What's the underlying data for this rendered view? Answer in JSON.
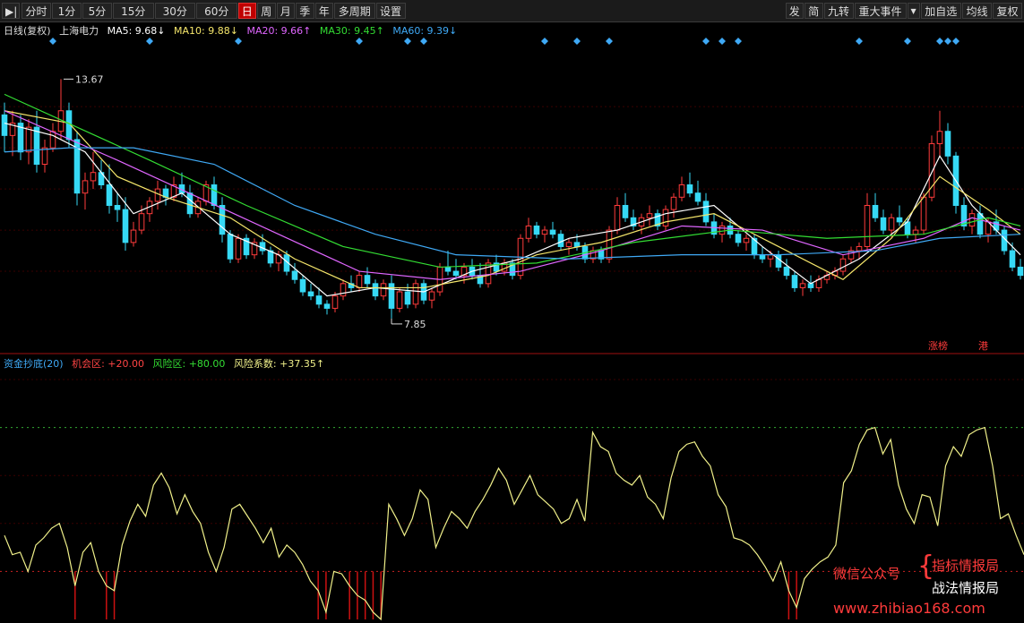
{
  "toolbar": {
    "left": [
      {
        "label": "分时"
      },
      {
        "label": "1分"
      },
      {
        "label": "5分"
      },
      {
        "label": "15分"
      },
      {
        "label": "30分"
      },
      {
        "label": "60分"
      },
      {
        "label": "日",
        "active": true
      },
      {
        "label": "周"
      },
      {
        "label": "月"
      },
      {
        "label": "季"
      },
      {
        "label": "年"
      },
      {
        "label": "多周期"
      },
      {
        "label": "设置"
      }
    ],
    "right": [
      {
        "label": "发"
      },
      {
        "label": "简"
      },
      {
        "label": "九转"
      },
      {
        "label": "重大事件"
      },
      {
        "label": "加自选"
      },
      {
        "label": "均线"
      },
      {
        "label": "复权"
      }
    ]
  },
  "legend": {
    "period": "日线(复权)",
    "stock": "上海电力",
    "ma5": "MA5: 9.68↓",
    "ma10": "MA10: 9.88↓",
    "ma20": "MA20: 9.66↑",
    "ma30": "MA30: 9.45↑",
    "ma60": "MA60: 9.39↓"
  },
  "colors": {
    "up": "#ff3b3b",
    "down": "#36d9f5",
    "ma5": "#ffffff",
    "ma10": "#f5e66b",
    "ma20": "#e066ff",
    "ma30": "#33dd33",
    "ma60": "#3fa9f5",
    "indicator": "#f0f08a"
  },
  "annotations": {
    "high_label": "13.67",
    "low_label": "7.85",
    "tag_zhangbang": "涨榜",
    "tag_gang": "港"
  },
  "indicator_legend": {
    "name": "资金抄底(20)",
    "chance": "机会区: +20.00",
    "risk": "风险区: +80.00",
    "coef": "风险系数: +37.35↑"
  },
  "watermark": {
    "wechat": "微信公众号",
    "line1": "指标情报局",
    "line2": "战法情报局",
    "url": "www.zhibiao168.com"
  },
  "chart_data": {
    "type": "candlestick",
    "title": "",
    "y_price_range": [
      7.5,
      14.2
    ],
    "high": 13.67,
    "low": 7.85,
    "candles": [
      [
        12.8,
        13.1,
        11.9,
        12.3
      ],
      [
        12.3,
        12.9,
        11.8,
        12.6
      ],
      [
        12.6,
        12.8,
        11.7,
        11.9
      ],
      [
        11.9,
        12.7,
        11.6,
        12.5
      ],
      [
        12.5,
        12.9,
        11.4,
        11.6
      ],
      [
        11.6,
        12.2,
        11.4,
        12.0
      ],
      [
        12.0,
        12.6,
        11.9,
        12.4
      ],
      [
        12.4,
        13.67,
        12.2,
        12.9
      ],
      [
        12.9,
        13.1,
        12.0,
        12.2
      ],
      [
        12.2,
        12.4,
        10.6,
        10.9
      ],
      [
        10.9,
        11.4,
        10.5,
        11.2
      ],
      [
        11.2,
        11.9,
        11.0,
        11.4
      ],
      [
        11.4,
        11.7,
        11.0,
        11.1
      ],
      [
        11.1,
        11.6,
        10.4,
        10.6
      ],
      [
        10.6,
        10.9,
        10.2,
        10.5
      ],
      [
        10.5,
        10.8,
        9.5,
        9.7
      ],
      [
        9.7,
        10.2,
        9.6,
        10.0
      ],
      [
        10.0,
        10.6,
        9.9,
        10.4
      ],
      [
        10.4,
        10.8,
        10.2,
        10.7
      ],
      [
        10.7,
        11.2,
        10.5,
        11.0
      ],
      [
        11.0,
        11.1,
        10.6,
        10.8
      ],
      [
        10.8,
        11.3,
        10.7,
        11.1
      ],
      [
        11.1,
        11.4,
        10.8,
        10.9
      ],
      [
        10.9,
        11.1,
        10.3,
        10.4
      ],
      [
        10.4,
        10.8,
        10.3,
        10.7
      ],
      [
        10.7,
        11.2,
        10.6,
        11.1
      ],
      [
        11.1,
        11.3,
        10.5,
        10.6
      ],
      [
        10.6,
        10.8,
        9.7,
        9.9
      ],
      [
        9.9,
        10.0,
        9.2,
        9.3
      ],
      [
        9.3,
        9.9,
        9.2,
        9.8
      ],
      [
        9.8,
        9.9,
        9.3,
        9.4
      ],
      [
        9.4,
        9.8,
        9.3,
        9.7
      ],
      [
        9.7,
        9.9,
        9.4,
        9.5
      ],
      [
        9.5,
        9.6,
        9.1,
        9.2
      ],
      [
        9.2,
        9.5,
        9.0,
        9.4
      ],
      [
        9.4,
        9.5,
        8.9,
        9.0
      ],
      [
        9.0,
        9.2,
        8.7,
        8.8
      ],
      [
        8.8,
        8.9,
        8.4,
        8.5
      ],
      [
        8.5,
        8.7,
        8.3,
        8.4
      ],
      [
        8.4,
        8.6,
        8.1,
        8.2
      ],
      [
        8.2,
        8.3,
        7.95,
        8.1
      ],
      [
        8.1,
        8.5,
        8.0,
        8.4
      ],
      [
        8.4,
        8.8,
        8.3,
        8.7
      ],
      [
        8.7,
        8.9,
        8.5,
        8.6
      ],
      [
        8.6,
        9.0,
        8.5,
        8.9
      ],
      [
        8.9,
        9.1,
        8.6,
        8.7
      ],
      [
        8.7,
        8.8,
        8.3,
        8.4
      ],
      [
        8.4,
        8.8,
        8.3,
        8.7
      ],
      [
        8.7,
        8.9,
        7.85,
        8.1
      ],
      [
        8.1,
        8.6,
        8.0,
        8.5
      ],
      [
        8.5,
        8.7,
        8.1,
        8.2
      ],
      [
        8.2,
        8.8,
        8.1,
        8.7
      ],
      [
        8.7,
        8.8,
        8.2,
        8.3
      ],
      [
        8.3,
        8.6,
        8.1,
        8.5
      ],
      [
        8.5,
        9.2,
        8.4,
        9.1
      ],
      [
        9.1,
        9.5,
        8.9,
        9.0
      ],
      [
        9.0,
        9.3,
        8.8,
        8.9
      ],
      [
        8.9,
        9.2,
        8.7,
        9.1
      ],
      [
        9.1,
        9.3,
        8.8,
        8.9
      ],
      [
        8.9,
        9.2,
        8.6,
        8.7
      ],
      [
        8.7,
        9.3,
        8.6,
        9.2
      ],
      [
        9.2,
        9.4,
        8.9,
        9.0
      ],
      [
        9.0,
        9.3,
        8.9,
        9.2
      ],
      [
        9.2,
        9.3,
        8.8,
        8.9
      ],
      [
        8.9,
        9.9,
        8.8,
        9.8
      ],
      [
        9.8,
        10.3,
        9.7,
        10.1
      ],
      [
        10.1,
        10.2,
        9.8,
        9.9
      ],
      [
        9.9,
        10.1,
        9.7,
        10.0
      ],
      [
        10.0,
        10.2,
        9.8,
        9.9
      ],
      [
        9.9,
        10.0,
        9.5,
        9.6
      ],
      [
        9.6,
        9.8,
        9.4,
        9.7
      ],
      [
        9.7,
        9.9,
        9.5,
        9.6
      ],
      [
        9.6,
        9.7,
        9.2,
        9.3
      ],
      [
        9.3,
        9.6,
        9.2,
        9.5
      ],
      [
        9.5,
        9.6,
        9.2,
        9.3
      ],
      [
        9.3,
        10.1,
        9.2,
        10.0
      ],
      [
        10.0,
        10.8,
        9.9,
        10.6
      ],
      [
        10.6,
        10.9,
        10.2,
        10.3
      ],
      [
        10.3,
        10.5,
        10.0,
        10.1
      ],
      [
        10.1,
        10.4,
        9.9,
        10.3
      ],
      [
        10.3,
        10.6,
        10.1,
        10.4
      ],
      [
        10.4,
        10.5,
        10.0,
        10.1
      ],
      [
        10.1,
        10.6,
        10.0,
        10.5
      ],
      [
        10.5,
        10.9,
        10.3,
        10.8
      ],
      [
        10.8,
        11.3,
        10.7,
        11.1
      ],
      [
        11.1,
        11.4,
        10.8,
        10.9
      ],
      [
        10.9,
        11.2,
        10.6,
        10.7
      ],
      [
        10.7,
        10.9,
        10.1,
        10.2
      ],
      [
        10.2,
        10.4,
        9.8,
        9.9
      ],
      [
        9.9,
        10.2,
        9.7,
        10.1
      ],
      [
        10.1,
        10.3,
        9.8,
        9.9
      ],
      [
        9.9,
        10.0,
        9.6,
        9.7
      ],
      [
        9.7,
        9.9,
        9.5,
        9.8
      ],
      [
        9.8,
        9.9,
        9.3,
        9.4
      ],
      [
        9.4,
        9.6,
        9.2,
        9.3
      ],
      [
        9.3,
        9.5,
        9.1,
        9.4
      ],
      [
        9.4,
        9.5,
        9.0,
        9.1
      ],
      [
        9.1,
        9.3,
        8.8,
        8.9
      ],
      [
        8.9,
        9.0,
        8.5,
        8.6
      ],
      [
        8.6,
        8.8,
        8.4,
        8.7
      ],
      [
        8.7,
        8.9,
        8.5,
        8.6
      ],
      [
        8.6,
        8.9,
        8.5,
        8.8
      ],
      [
        8.8,
        9.0,
        8.7,
        8.9
      ],
      [
        8.9,
        9.1,
        8.8,
        9.0
      ],
      [
        9.0,
        9.4,
        8.9,
        9.3
      ],
      [
        9.3,
        9.6,
        9.2,
        9.5
      ],
      [
        9.5,
        9.7,
        9.3,
        9.6
      ],
      [
        9.6,
        10.9,
        9.5,
        10.6
      ],
      [
        10.6,
        10.9,
        10.2,
        10.3
      ],
      [
        10.3,
        10.5,
        9.9,
        10.0
      ],
      [
        10.0,
        10.4,
        9.8,
        10.3
      ],
      [
        10.3,
        10.6,
        10.1,
        10.2
      ],
      [
        10.2,
        10.3,
        9.8,
        9.9
      ],
      [
        9.9,
        10.1,
        9.7,
        10.0
      ],
      [
        10.0,
        10.9,
        9.9,
        10.8
      ],
      [
        10.8,
        12.3,
        10.7,
        12.1
      ],
      [
        12.1,
        12.9,
        11.8,
        12.4
      ],
      [
        12.4,
        12.6,
        11.6,
        11.8
      ],
      [
        11.8,
        11.9,
        10.4,
        10.6
      ],
      [
        10.6,
        10.8,
        10.0,
        10.1
      ],
      [
        10.1,
        10.5,
        9.9,
        10.4
      ],
      [
        10.4,
        10.6,
        9.8,
        9.9
      ],
      [
        9.9,
        10.3,
        9.7,
        10.2
      ],
      [
        10.2,
        10.5,
        9.9,
        10.0
      ],
      [
        10.0,
        10.1,
        9.4,
        9.5
      ],
      [
        9.5,
        9.7,
        9.0,
        9.1
      ],
      [
        9.1,
        9.3,
        8.8,
        8.9
      ]
    ],
    "ma_lines": [
      {
        "key": "ma5",
        "points": [
          [
            0,
            12.6
          ],
          [
            6,
            12.3
          ],
          [
            10,
            11.9
          ],
          [
            16,
            10.4
          ],
          [
            22,
            10.9
          ],
          [
            28,
            9.9
          ],
          [
            34,
            9.4
          ],
          [
            40,
            8.4
          ],
          [
            46,
            8.6
          ],
          [
            52,
            8.5
          ],
          [
            58,
            9.0
          ],
          [
            64,
            9.3
          ],
          [
            70,
            9.8
          ],
          [
            76,
            10.0
          ],
          [
            82,
            10.4
          ],
          [
            88,
            10.6
          ],
          [
            94,
            9.6
          ],
          [
            100,
            8.7
          ],
          [
            106,
            9.3
          ],
          [
            112,
            10.2
          ],
          [
            116,
            11.8
          ],
          [
            120,
            10.6
          ],
          [
            126,
            9.4
          ]
        ]
      },
      {
        "key": "ma10",
        "points": [
          [
            0,
            12.9
          ],
          [
            8,
            12.6
          ],
          [
            14,
            11.3
          ],
          [
            20,
            10.8
          ],
          [
            28,
            10.3
          ],
          [
            36,
            9.3
          ],
          [
            44,
            8.6
          ],
          [
            52,
            8.6
          ],
          [
            60,
            8.9
          ],
          [
            66,
            9.4
          ],
          [
            74,
            9.7
          ],
          [
            82,
            10.2
          ],
          [
            88,
            10.4
          ],
          [
            96,
            9.6
          ],
          [
            104,
            8.8
          ],
          [
            110,
            9.8
          ],
          [
            116,
            11.3
          ],
          [
            122,
            10.5
          ],
          [
            126,
            9.9
          ]
        ]
      },
      {
        "key": "ma20",
        "points": [
          [
            0,
            12.9
          ],
          [
            14,
            11.7
          ],
          [
            24,
            10.8
          ],
          [
            34,
            9.9
          ],
          [
            44,
            9.0
          ],
          [
            54,
            8.8
          ],
          [
            64,
            9.0
          ],
          [
            74,
            9.5
          ],
          [
            84,
            10.1
          ],
          [
            94,
            10.0
          ],
          [
            104,
            9.4
          ],
          [
            114,
            9.8
          ],
          [
            120,
            10.3
          ],
          [
            126,
            10.0
          ]
        ]
      },
      {
        "key": "ma30",
        "points": [
          [
            0,
            13.3
          ],
          [
            18,
            11.7
          ],
          [
            30,
            10.6
          ],
          [
            42,
            9.6
          ],
          [
            54,
            9.1
          ],
          [
            66,
            9.2
          ],
          [
            78,
            9.7
          ],
          [
            90,
            10.0
          ],
          [
            102,
            9.8
          ],
          [
            114,
            9.9
          ],
          [
            122,
            10.3
          ],
          [
            126,
            10.1
          ]
        ]
      },
      {
        "key": "ma60",
        "points": [
          [
            0,
            11.9
          ],
          [
            8,
            12.0
          ],
          [
            16,
            12.0
          ],
          [
            26,
            11.6
          ],
          [
            36,
            10.6
          ],
          [
            46,
            9.9
          ],
          [
            56,
            9.4
          ],
          [
            70,
            9.3
          ],
          [
            84,
            9.4
          ],
          [
            96,
            9.4
          ],
          [
            108,
            9.5
          ],
          [
            116,
            9.8
          ],
          [
            126,
            9.9
          ]
        ]
      }
    ],
    "event_markers": [
      6,
      18,
      29,
      44,
      50,
      52,
      67,
      71,
      75,
      87,
      89,
      91,
      106,
      112,
      116,
      117,
      118
    ],
    "indicator": {
      "name": "资金抄底(20)",
      "ylim": [
        0,
        100
      ],
      "chance_level": 20,
      "risk_level": 80,
      "values": [
        35,
        27,
        28,
        20,
        31,
        34,
        38,
        40,
        30,
        14,
        28,
        32,
        20,
        14,
        12,
        31,
        41,
        48,
        43,
        56,
        61,
        55,
        44,
        52,
        45,
        40,
        28,
        20,
        30,
        46,
        48,
        43,
        38,
        32,
        38,
        26,
        31,
        28,
        23,
        16,
        12,
        3,
        20,
        19,
        14,
        10,
        8,
        3,
        0,
        48,
        42,
        35,
        42,
        54,
        50,
        30,
        38,
        45,
        42,
        38,
        45,
        50,
        56,
        63,
        58,
        48,
        54,
        60,
        52,
        49,
        46,
        40,
        42,
        50,
        41,
        78,
        72,
        70,
        61,
        58,
        56,
        60,
        51,
        48,
        42,
        59,
        70,
        73,
        74,
        68,
        64,
        52,
        47,
        34,
        33,
        31,
        27,
        22,
        16,
        24,
        12,
        5,
        17,
        21,
        24,
        26,
        31,
        57,
        62,
        73,
        79,
        80,
        69,
        75,
        56,
        46,
        40,
        52,
        51,
        39,
        64,
        72,
        68,
        77,
        79,
        80,
        64,
        42,
        44,
        35,
        27
      ]
    }
  }
}
